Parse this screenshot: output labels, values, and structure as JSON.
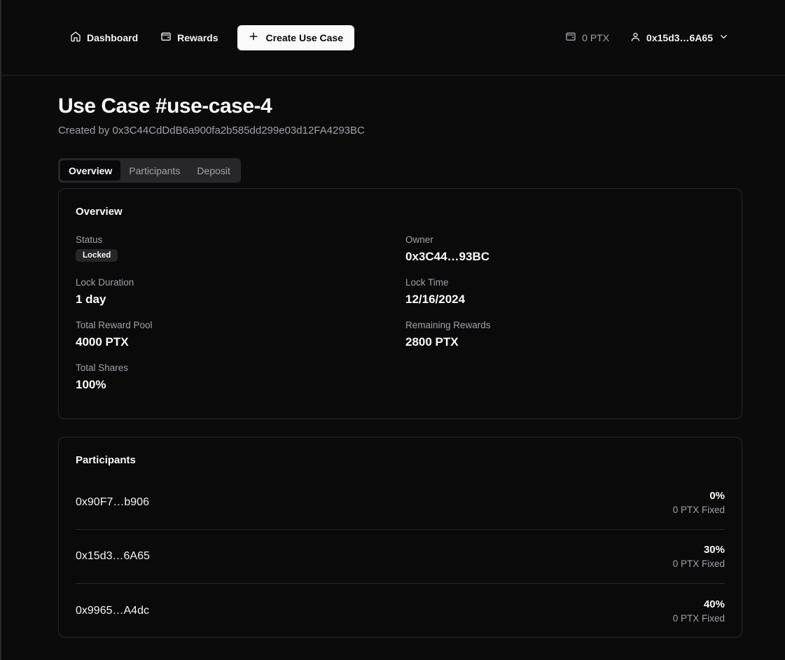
{
  "header": {
    "nav": [
      {
        "label": "Dashboard",
        "icon": "home-icon"
      },
      {
        "label": "Rewards",
        "icon": "wallet-icon"
      }
    ],
    "create_label": "Create Use Case",
    "balance": "0 PTX",
    "account": "0x15d3…6A65"
  },
  "page": {
    "title": "Use Case #use-case-4",
    "creator": "Created by 0x3C44CdDdB6a900fa2b585dd299e03d12FA4293BC"
  },
  "tabs": [
    "Overview",
    "Participants",
    "Deposit"
  ],
  "overview": {
    "title": "Overview",
    "status_label": "Status",
    "status_value": "Locked",
    "owner_label": "Owner",
    "owner_value": "0x3C44…93BC",
    "lock_duration_label": "Lock Duration",
    "lock_duration_value": "1 day",
    "lock_time_label": "Lock Time",
    "lock_time_value": "12/16/2024",
    "total_pool_label": "Total Reward Pool",
    "total_pool_value": "4000 PTX",
    "remaining_label": "Remaining Rewards",
    "remaining_value": "2800 PTX",
    "total_shares_label": "Total Shares",
    "total_shares_value": "100%"
  },
  "participants": {
    "title": "Participants",
    "rows": [
      {
        "address": "0x90F7…b906",
        "share": "0%",
        "fixed": "0 PTX Fixed"
      },
      {
        "address": "0x15d3…6A65",
        "share": "30%",
        "fixed": "0 PTX Fixed"
      },
      {
        "address": "0x9965…A4dc",
        "share": "40%",
        "fixed": "0 PTX Fixed"
      }
    ]
  },
  "colors": {
    "background": "#0b0b0c",
    "card_border": "#27272a",
    "muted_text": "#a1a1aa",
    "primary_button": "#fafafa"
  }
}
